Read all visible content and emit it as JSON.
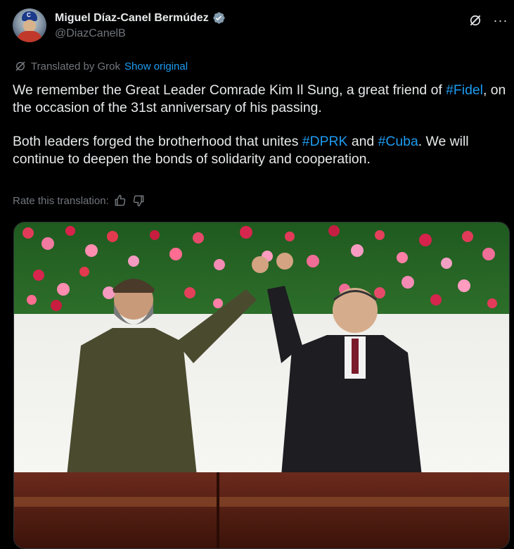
{
  "author": {
    "display_name": "Miguel Díaz-Canel Bermúdez",
    "handle": "@DiazCanelB",
    "verified": true,
    "avatar_letter": "C"
  },
  "translation": {
    "label": "Translated by Grok",
    "show_original": "Show original"
  },
  "tweet": {
    "p1_a": "We remember the Great Leader Comrade Kim Il Sung, a great friend of ",
    "p1_tag": "#Fidel",
    "p1_b": ", on the occasion of the 31st anniversary of his passing.",
    "p2_a": "Both leaders forged the brotherhood that unites ",
    "p2_tag1": "#DPRK",
    "p2_and": " and ",
    "p2_tag2": "#Cuba",
    "p2_b": ". We will continue to deepen the bonds of solidarity and cooperation."
  },
  "rate": {
    "label": "Rate this translation:"
  },
  "colors": {
    "link": "#1d9bf0",
    "secondary_text": "#71767b",
    "verified_badge": "#829aab"
  },
  "icons": {
    "verified": "verified-badge-icon",
    "grok": "grok-icon",
    "more": "more-icon",
    "thumbs_up": "thumbs-up-icon",
    "thumbs_down": "thumbs-down-icon"
  }
}
